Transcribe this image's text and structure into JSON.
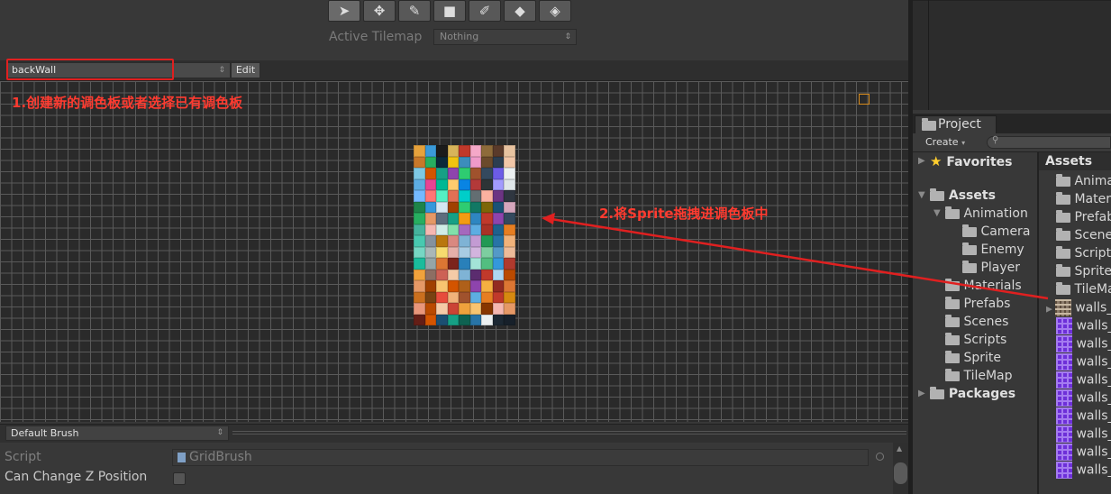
{
  "tile_palette": {
    "tools": [
      {
        "name": "select-tool",
        "glyph": "➤",
        "active": true
      },
      {
        "name": "move-tool",
        "glyph": "✥",
        "active": false
      },
      {
        "name": "brush-tool",
        "glyph": "✎",
        "active": false
      },
      {
        "name": "box-fill-tool",
        "glyph": "■",
        "active": false
      },
      {
        "name": "picker-tool",
        "glyph": "✐",
        "active": false
      },
      {
        "name": "eraser-tool",
        "glyph": "◆",
        "active": false
      },
      {
        "name": "fill-tool",
        "glyph": "◈",
        "active": false
      }
    ],
    "active_tilemap_label": "Active Tilemap",
    "active_tilemap_value": "Nothing",
    "palette_name": "backWall",
    "edit_label": "Edit",
    "annotation_1": "1.创建新的调色板或者选择已有调色板",
    "annotation_2": "2.将Sprite拖拽进调色板中",
    "annotation_color": "#ff3b30"
  },
  "brush": {
    "dropdown_value": "Default Brush",
    "fields": {
      "script_label": "Script",
      "script_value": "GridBrush",
      "can_change_z_label": "Can Change Z Position",
      "can_change_z_checked": false
    }
  },
  "project": {
    "tab_label": "Project",
    "create_label": "Create",
    "tree": {
      "favorites": "Favorites",
      "assets": "Assets",
      "animation": "Animation",
      "camera": "Camera",
      "enemy": "Enemy",
      "player": "Player",
      "materials": "Materials",
      "prefabs": "Prefabs",
      "scenes": "Scenes",
      "scripts": "Scripts",
      "sprite": "Sprite",
      "tilemap": "TileMap",
      "packages": "Packages"
    },
    "assets_header": "Assets",
    "assets_list": [
      "Anima",
      "Mater",
      "Prefab",
      "Scene",
      "Script",
      "Sprite",
      "TileMa"
    ],
    "sprite_items": [
      "walls_",
      "walls_",
      "walls_",
      "walls_",
      "walls_",
      "walls_",
      "walls_",
      "walls_",
      "walls_",
      "walls_"
    ]
  },
  "tile_colors": [
    "#e6a23c",
    "#3a9ad9",
    "#1b1b1b",
    "#d8b45a",
    "#c0392b",
    "#f5a8c8",
    "#8e6b3a",
    "#5a3a2a",
    "#e8c3a0",
    "#c8782a",
    "#27ae60",
    "#0b2a3a",
    "#f1c40f",
    "#3c8dbc",
    "#ef9ac9",
    "#6b4a2b",
    "#2c3e50",
    "#f2c7a8",
    "#7ec8e3",
    "#d35400",
    "#16a085",
    "#8e44ad",
    "#2ecc71",
    "#a0522d",
    "#34495e",
    "#6c5ce7",
    "#ecf0f1",
    "#5dade2",
    "#e84393",
    "#00b894",
    "#fdcb6e",
    "#0984e3",
    "#b33939",
    "#2d3436",
    "#a29bfe",
    "#dfe6e9",
    "#74b9ff",
    "#ff7675",
    "#55efc4",
    "#e17055",
    "#00cec9",
    "#636e72",
    "#fab1a0",
    "#6c3483",
    "#2f3640",
    "#1e8449",
    "#3498db",
    "#d4e6f1",
    "#a04000",
    "#2ecc71",
    "#117864",
    "#7d6608",
    "#1a5276",
    "#d5a6bd",
    "#27ae60",
    "#e59866",
    "#5d6d7e",
    "#16a085",
    "#f39c12",
    "#2e86c1",
    "#c0392b",
    "#8e44ad",
    "#34495e",
    "#45b39d",
    "#f5b7b1",
    "#d0ece7",
    "#82e0aa",
    "#a569bd",
    "#5dade2",
    "#a93226",
    "#1f618d",
    "#e67e22",
    "#48c9b0",
    "#85929e",
    "#b9770e",
    "#d98880",
    "#7fb3d5",
    "#c39bd3",
    "#229954",
    "#2874a6",
    "#f0b27a",
    "#76d7c4",
    "#aab7b8",
    "#f7dc6f",
    "#e6b0aa",
    "#a9cce3",
    "#d2b4de",
    "#7dcea0",
    "#5499c7",
    "#edbb99",
    "#1abc9c",
    "#95a5a6",
    "#dc7633",
    "#7b241c",
    "#2980b9",
    "#a3e4d7",
    "#52be80",
    "#3498db",
    "#b03a2e",
    "#f0a23c",
    "#8d6e63",
    "#cd6155",
    "#f5cba7",
    "#7fb3d5",
    "#5b2c6f",
    "#c0392b",
    "#aed6f1",
    "#ba4a00",
    "#e59866",
    "#a04000",
    "#f8c471",
    "#d35400",
    "#af601a",
    "#8e44ad",
    "#f5b041",
    "#922b21",
    "#dc7633",
    "#ca6f1e",
    "#784212",
    "#e74c3c",
    "#f0b27a",
    "#a0522d",
    "#5dade2",
    "#e67e22",
    "#c0392b",
    "#d68910",
    "#e9967a",
    "#ba4a00",
    "#f5cba7",
    "#cb4335",
    "#f0a23c",
    "#f8c471",
    "#873600",
    "#f5b7b1",
    "#e59866",
    "#641e16",
    "#d35400",
    "#1b4f72",
    "#16a085",
    "#0e6251",
    "#2874a6",
    "#ecf0f1",
    "#1c2833",
    "#17202a"
  ]
}
